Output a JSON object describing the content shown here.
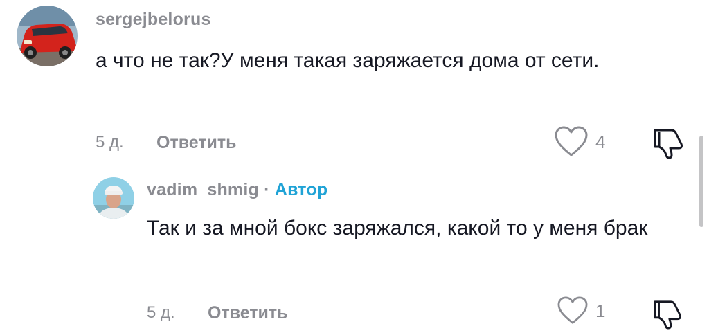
{
  "comments": [
    {
      "username": "sergejbelorus",
      "text": "а что не так?У меня такая заряжается дома от сети.",
      "time": "5 д.",
      "reply_label": "Ответить",
      "likes": "4",
      "avatar_icon": "red-car-photo"
    },
    {
      "username": "vadim_shmig",
      "author_separator": " · ",
      "author_badge": "Автор",
      "text": "Так и за мной бокс заряжался, какой то у меня брак",
      "time": "5 д.",
      "reply_label": "Ответить",
      "likes": "1",
      "avatar_icon": "man-portrait-photo"
    }
  ],
  "colors": {
    "text": "#161823",
    "muted": "#8a8b91",
    "author_accent": "#20a3d6"
  },
  "icons": {
    "like": "heart-outline-icon",
    "dislike": "thumbs-down-outline-icon"
  }
}
